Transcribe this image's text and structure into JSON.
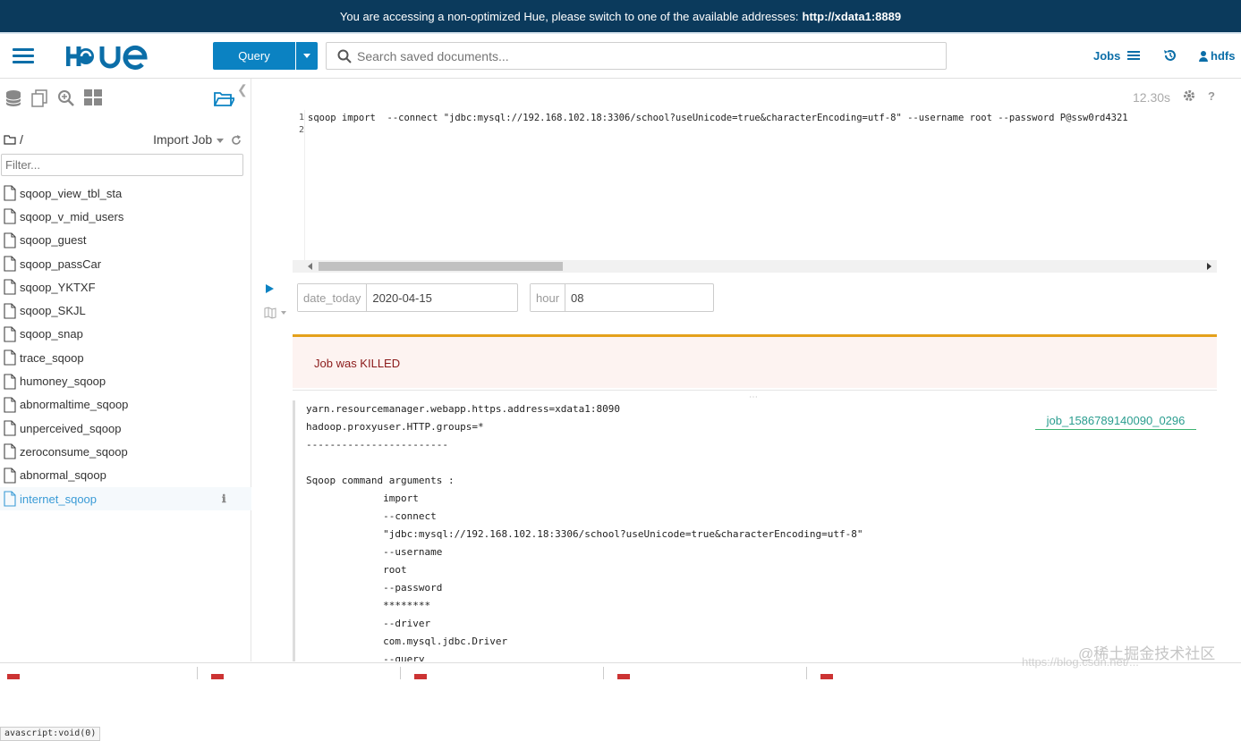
{
  "banner": {
    "text": "You are accessing a non-optimized Hue, please switch to one of the available addresses:",
    "address": "http://xdata1:8889"
  },
  "navbar": {
    "logo": "HUE",
    "query_label": "Query",
    "search_placeholder": "Search saved documents...",
    "jobs_label": "Jobs",
    "user_label": "hdfs"
  },
  "sidebar": {
    "path": "/",
    "import_label": "Import Job",
    "filter_placeholder": "Filter...",
    "files": [
      "sqoop_view_tbl_sta",
      "sqoop_v_mid_users",
      "sqoop_guest",
      "sqoop_passCar",
      "sqoop_YKTXF",
      "sqoop_SKJL",
      "sqoop_snap",
      "trace_sqoop",
      "humoney_sqoop",
      "abnormaltime_sqoop",
      "unperceived_sqoop",
      "zeroconsume_sqoop",
      "abnormal_sqoop",
      "internet_sqoop"
    ],
    "status_link": "avascript:void(0)"
  },
  "editor": {
    "timer": "12.30s",
    "line_numbers": [
      "1",
      "2"
    ],
    "code_line1": "sqoop import  --connect \"jdbc:mysql://192.168.102.18:3306/school?useUnicode=true&characterEncoding=utf-8\" --username root --password P@ssw0rd4321",
    "code_line2": ""
  },
  "params": [
    {
      "label": "date_today",
      "value": "2020-04-15"
    },
    {
      "label": "hour",
      "value": "08"
    }
  ],
  "alert": {
    "text": "Job was KILLED"
  },
  "log": {
    "job_link": "job_1586789140090_0296",
    "lines": [
      "yarn.resourcemanager.webapp.https.address=xdata1:8090",
      "hadoop.proxyuser.HTTP.groups=*",
      "------------------------",
      "",
      "Sqoop command arguments :",
      "             import",
      "             --connect",
      "             \"jdbc:mysql://192.168.102.18:3306/school?useUnicode=true&characterEncoding=utf-8\"",
      "             --username",
      "             root",
      "             --password",
      "             ********",
      "             --driver",
      "             com.mysql.jdbc.Driver",
      "             --query"
    ]
  },
  "watermark": {
    "text": "@稀土掘金技术社区",
    "url": "https://blog.csdn.net/..."
  },
  "colors": {
    "banner_bg": "#0b3a5c",
    "accent": "#0b82c2",
    "alert_border": "#e4a11b",
    "alert_text": "#8b1a1a",
    "job_link": "#2a9d8f"
  }
}
